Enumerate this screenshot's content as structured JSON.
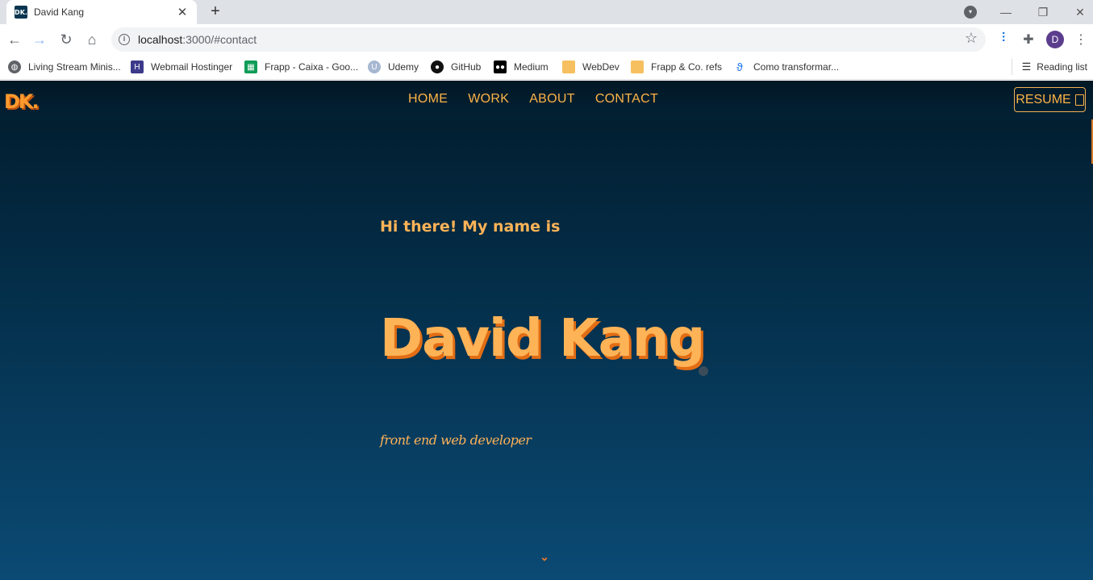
{
  "browser": {
    "tab": {
      "favicon_text": "DK.",
      "title": "David Kang",
      "close": "✕"
    },
    "new_tab": "+",
    "url_host": "localhost",
    "url_rest": ":3000/#contact",
    "bookmarks": [
      {
        "label": "Living Stream Minis...",
        "icon": "globe-icon"
      },
      {
        "label": "Webmail Hostinger",
        "icon": "hostinger-icon"
      },
      {
        "label": "Frapp - Caixa - Goo...",
        "icon": "sheets-icon"
      },
      {
        "label": "Udemy",
        "icon": "udemy-icon"
      },
      {
        "label": "GitHub",
        "icon": "github-icon"
      },
      {
        "label": "Medium",
        "icon": "medium-icon"
      },
      {
        "label": "WebDev",
        "icon": "folder-icon"
      },
      {
        "label": "Frapp & Co. refs",
        "icon": "folder-icon"
      },
      {
        "label": "Como transformar...",
        "icon": "bookmark-icon"
      }
    ],
    "reading_list": "Reading list",
    "profile_initial": "D"
  },
  "site": {
    "logo": "DK.",
    "nav": [
      "HOME",
      "WORK",
      "ABOUT",
      "CONTACT"
    ],
    "resume": "RESUME",
    "greeting": "Hi there! My name is",
    "name": "David Kang",
    "role": "front end web developer"
  },
  "colors": {
    "accent": "#ffb357",
    "accent_shadow": "#e26d14",
    "bg_top": "#021b2b",
    "bg_bottom": "#0b4a74"
  }
}
